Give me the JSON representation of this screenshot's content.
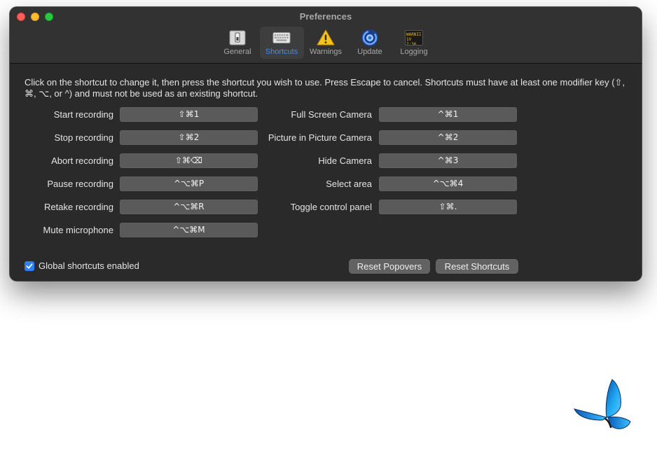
{
  "window": {
    "title": "Preferences"
  },
  "toolbar": {
    "items": [
      {
        "label": "General",
        "icon": "switch-icon",
        "active": false
      },
      {
        "label": "Shortcuts",
        "icon": "keyboard-icon",
        "active": true
      },
      {
        "label": "Warnings",
        "icon": "warning-icon",
        "active": false
      },
      {
        "label": "Update",
        "icon": "update-icon",
        "active": false
      },
      {
        "label": "Logging",
        "icon": "console-log-icon",
        "active": false
      }
    ],
    "logging_icon_text": [
      "WARNII",
      "1V 7:36"
    ]
  },
  "instructions": "Click on the shortcut to change it, then press the shortcut you wish to use. Press Escape to cancel. Shortcuts must have at least one modifier key (⇧, ⌘, ⌥, or ^) and must not be used as an existing shortcut.",
  "shortcuts_left": [
    {
      "label": "Start recording",
      "keys": "⇧⌘1"
    },
    {
      "label": "Stop recording",
      "keys": "⇧⌘2"
    },
    {
      "label": "Abort recording",
      "keys": "⇧⌘⌫"
    },
    {
      "label": "Pause recording",
      "keys": "^⌥⌘P"
    },
    {
      "label": "Retake recording",
      "keys": "^⌥⌘R"
    },
    {
      "label": "Mute microphone",
      "keys": "^⌥⌘M"
    }
  ],
  "shortcuts_right": [
    {
      "label": "Full Screen Camera",
      "keys": "^⌘1"
    },
    {
      "label": "Picture in Picture Camera",
      "keys": "^⌘2"
    },
    {
      "label": "Hide Camera",
      "keys": "^⌘3"
    },
    {
      "label": "Select area",
      "keys": "^⌥⌘4"
    },
    {
      "label": "Toggle control panel",
      "keys": "⇧⌘."
    }
  ],
  "global_shortcuts": {
    "label": "Global shortcuts enabled",
    "checked": true
  },
  "buttons": {
    "reset_popovers": "Reset Popovers",
    "reset_shortcuts": "Reset Shortcuts"
  },
  "colors": {
    "accent": "#3a8ef6",
    "window_bg": "#2a2a2a",
    "field_bg": "#5a5a5a",
    "checkbox": "#2f7ff6"
  }
}
